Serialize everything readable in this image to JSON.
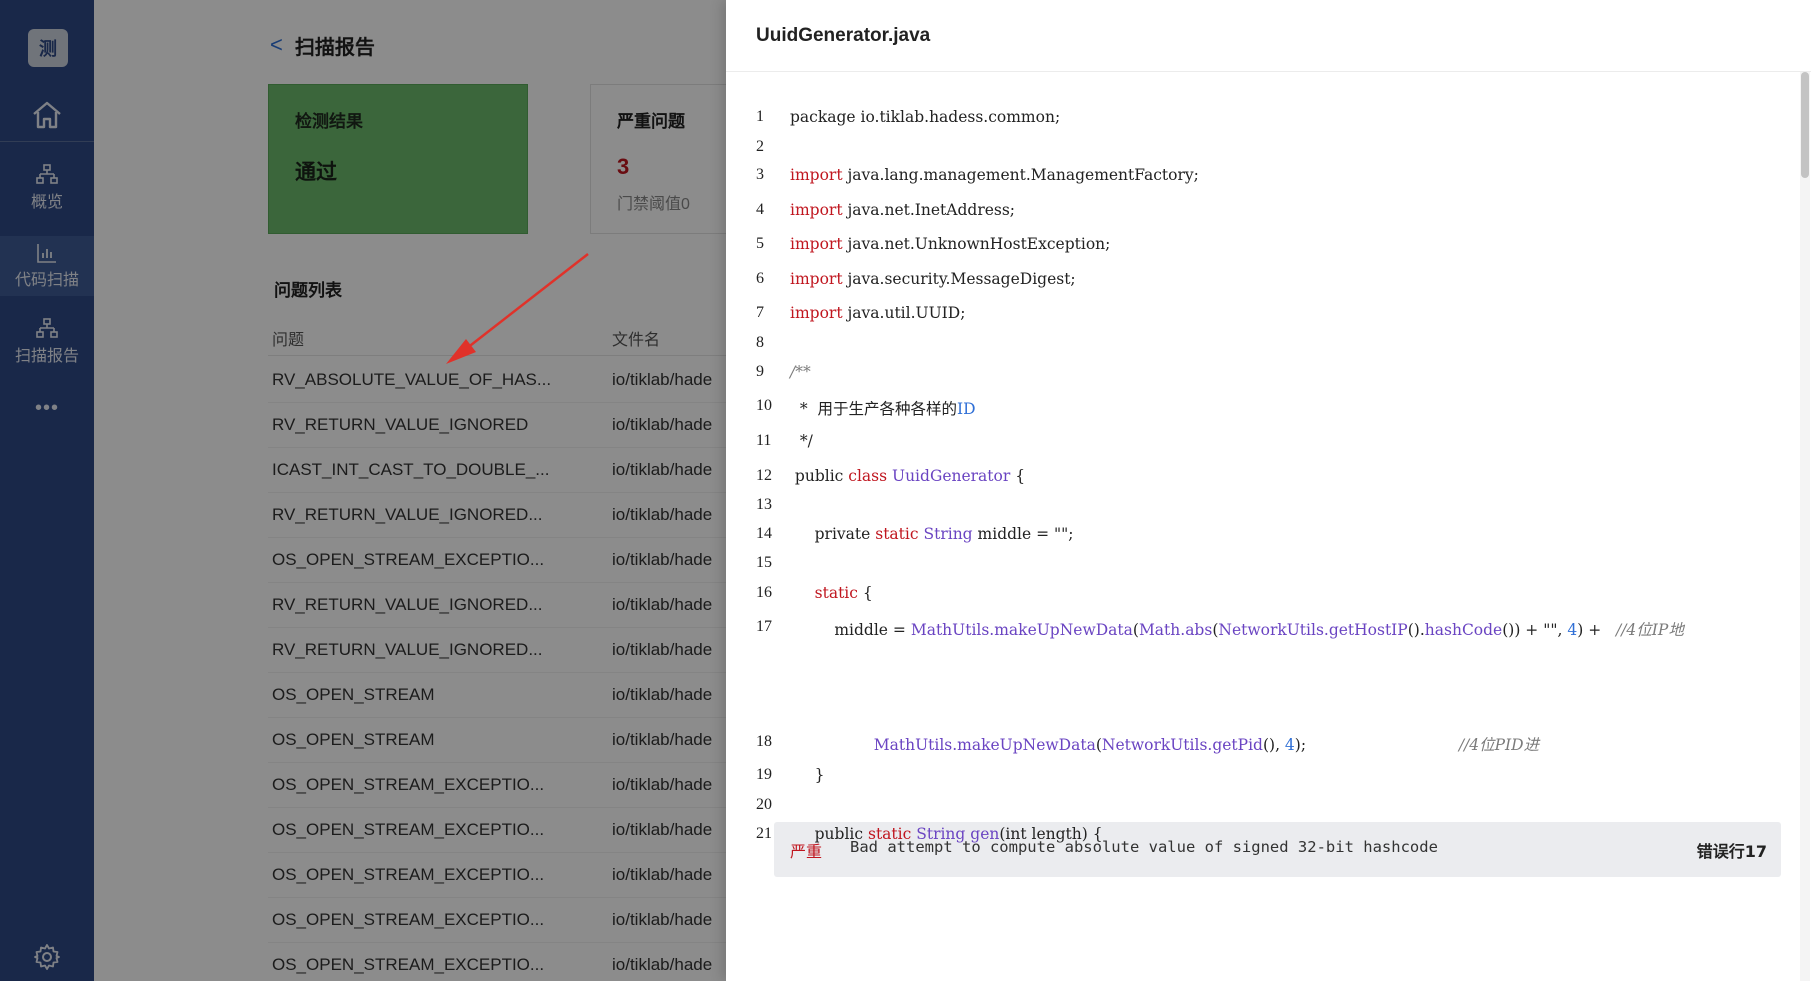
{
  "sidebar": {
    "logo": "测",
    "items": [
      {
        "label": "概览",
        "icon": "sitemap-icon"
      },
      {
        "label": "代码扫描",
        "icon": "bar-chart-icon",
        "active": true
      },
      {
        "label": "扫描报告",
        "icon": "sitemap-icon"
      }
    ],
    "more": "•••"
  },
  "header": {
    "back": "<",
    "title": "扫描报告"
  },
  "cards": {
    "result": {
      "label": "检测结果",
      "value": "通过",
      "color": "#6cbb6c"
    },
    "severe": {
      "label": "严重问题",
      "value": "3",
      "sub": "门禁阈值0",
      "color": "#c0161f"
    }
  },
  "issue_list": {
    "title": "问题列表",
    "columns": {
      "issue": "问题",
      "file": "文件名"
    },
    "rows": [
      {
        "issue": "RV_ABSOLUTE_VALUE_OF_HAS...",
        "file": "io/tiklab/hade"
      },
      {
        "issue": "RV_RETURN_VALUE_IGNORED",
        "file": "io/tiklab/hade"
      },
      {
        "issue": "ICAST_INT_CAST_TO_DOUBLE_...",
        "file": "io/tiklab/hade"
      },
      {
        "issue": "RV_RETURN_VALUE_IGNORED...",
        "file": "io/tiklab/hade"
      },
      {
        "issue": "OS_OPEN_STREAM_EXCEPTIO...",
        "file": "io/tiklab/hade"
      },
      {
        "issue": "RV_RETURN_VALUE_IGNORED...",
        "file": "io/tiklab/hade"
      },
      {
        "issue": "RV_RETURN_VALUE_IGNORED...",
        "file": "io/tiklab/hade"
      },
      {
        "issue": "OS_OPEN_STREAM",
        "file": "io/tiklab/hade"
      },
      {
        "issue": "OS_OPEN_STREAM",
        "file": "io/tiklab/hade"
      },
      {
        "issue": "OS_OPEN_STREAM_EXCEPTIO...",
        "file": "io/tiklab/hade"
      },
      {
        "issue": "OS_OPEN_STREAM_EXCEPTIO...",
        "file": "io/tiklab/hade"
      },
      {
        "issue": "OS_OPEN_STREAM_EXCEPTIO...",
        "file": "io/tiklab/hade"
      },
      {
        "issue": "OS_OPEN_STREAM_EXCEPTIO...",
        "file": "io/tiklab/hade"
      },
      {
        "issue": "OS_OPEN_STREAM_EXCEPTIO...",
        "file": "io/tiklab/hade"
      }
    ]
  },
  "drawer": {
    "title": "UuidGenerator.java",
    "lines": [
      {
        "n": "1",
        "parts": [
          [
            "",
            "package io.tiklab.hadess.common;"
          ]
        ]
      },
      {
        "n": "2",
        "parts": []
      },
      {
        "n": "3",
        "parts": [
          [
            "kw",
            "import"
          ],
          [
            "",
            " java.lang.management.ManagementFactory;"
          ]
        ]
      },
      {
        "n": "4",
        "parts": [
          [
            "kw",
            "import"
          ],
          [
            "",
            " java.net.InetAddress;"
          ]
        ]
      },
      {
        "n": "5",
        "parts": [
          [
            "kw",
            "import"
          ],
          [
            "",
            " java.net.UnknownHostException;"
          ]
        ]
      },
      {
        "n": "6",
        "parts": [
          [
            "kw",
            "import"
          ],
          [
            "",
            " java.security.MessageDigest;"
          ]
        ]
      },
      {
        "n": "7",
        "parts": [
          [
            "kw",
            "import"
          ],
          [
            "",
            " java.util.UUID;"
          ]
        ]
      },
      {
        "n": "8",
        "parts": []
      },
      {
        "n": "9",
        "parts": [
          [
            "cmt",
            "/**"
          ]
        ]
      },
      {
        "n": "10",
        "parts": [
          [
            "",
            "  *  用于生产各种各样的"
          ],
          [
            "num",
            "ID"
          ]
        ]
      },
      {
        "n": "11",
        "parts": [
          [
            "",
            "  */"
          ]
        ]
      },
      {
        "n": "12",
        "parts": [
          [
            "",
            " public "
          ],
          [
            "kw",
            "class"
          ],
          [
            "",
            " "
          ],
          [
            "fn",
            "UuidGenerator"
          ],
          [
            "",
            " {"
          ]
        ]
      },
      {
        "n": "13",
        "parts": []
      },
      {
        "n": "14",
        "parts": [
          [
            "",
            "     private "
          ],
          [
            "kw",
            "static"
          ],
          [
            "",
            " "
          ],
          [
            "fn",
            "String"
          ],
          [
            "",
            " middle = \"\";"
          ]
        ]
      },
      {
        "n": "15",
        "parts": []
      },
      {
        "n": "16",
        "parts": [
          [
            "",
            "     "
          ],
          [
            "kw",
            "static"
          ],
          [
            "",
            " {"
          ]
        ]
      },
      {
        "n": "17",
        "parts": [
          [
            "",
            "         middle = "
          ],
          [
            "fn",
            "MathUtils.makeUpNewData"
          ],
          [
            "",
            "("
          ],
          [
            "fn",
            "Math.abs"
          ],
          [
            "",
            "("
          ],
          [
            "fn",
            "NetworkUtils.getHostIP"
          ],
          [
            "",
            "()."
          ],
          [
            "fn",
            "hashCode"
          ],
          [
            "",
            "()) + \"\", "
          ],
          [
            "num",
            "4"
          ],
          [
            "",
            ") +   "
          ],
          [
            "cmt",
            "//4位IP地"
          ]
        ]
      },
      {
        "n": "18",
        "parts": [
          [
            "",
            "                 "
          ],
          [
            "fn",
            "MathUtils.makeUpNewData"
          ],
          [
            "",
            "("
          ],
          [
            "fn",
            "NetworkUtils.getPid"
          ],
          [
            "",
            "(), "
          ],
          [
            "num",
            "4"
          ],
          [
            "",
            ");                               "
          ],
          [
            "cmt",
            "//4位PID进"
          ]
        ]
      },
      {
        "n": "19",
        "parts": [
          [
            "",
            "     }"
          ]
        ]
      },
      {
        "n": "20",
        "parts": []
      },
      {
        "n": "21",
        "parts": [
          [
            "",
            "     public "
          ],
          [
            "kw",
            "static"
          ],
          [
            "",
            " "
          ],
          [
            "fn",
            "String"
          ],
          [
            "",
            " "
          ],
          [
            "fn",
            "gen"
          ],
          [
            "",
            "(int length) {"
          ]
        ]
      }
    ],
    "issue": {
      "severity": "严重",
      "message": "Bad attempt to compute absolute value of signed 32-bit hashcode",
      "line_label": "错误行17"
    }
  }
}
